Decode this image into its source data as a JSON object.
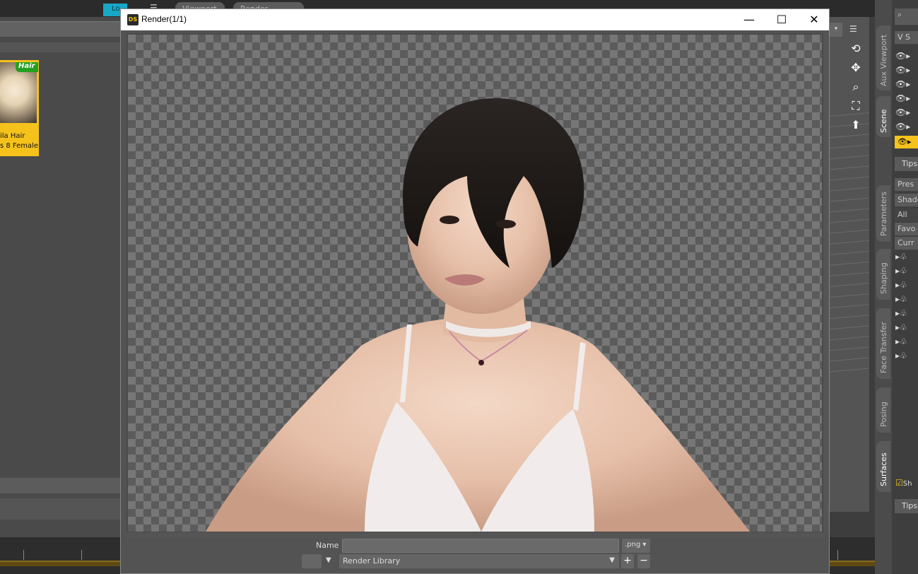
{
  "background_app": {
    "lock_label": "Lo",
    "tabs": [
      "Viewport",
      "Render Library"
    ],
    "content_card": {
      "badge": "Hair",
      "label_line1": "ila Hair",
      "label_line2": "s 8 Female"
    },
    "side_tabs": [
      "Aux Viewport",
      "Scene",
      "Parameters",
      "Shaping",
      "Face Transfer",
      "Posing",
      "Surfaces"
    ],
    "scene_panel": {
      "header_letter": "V",
      "header_text": "S"
    },
    "tips_label": "Tips",
    "surfaces_panel": {
      "preset_label": "Pres",
      "shader_label": "Shade",
      "filters": [
        "All",
        "Favo",
        "Curr"
      ],
      "checkbox_label": "Sh"
    }
  },
  "render_window": {
    "title": "Render(1/1)",
    "app_icon": "DS",
    "controls": {
      "minimize": "—",
      "maximize": "☐",
      "close": "✕"
    },
    "name_label": "Name :",
    "name_value": "",
    "format_value": ".png ▾",
    "library_value": "Render Library",
    "add_label": "+",
    "remove_label": "−"
  },
  "colors": {
    "accent_yellow": "#f5c21c",
    "lock_cyan": "#17a7c7",
    "badge_green": "#24a020"
  }
}
